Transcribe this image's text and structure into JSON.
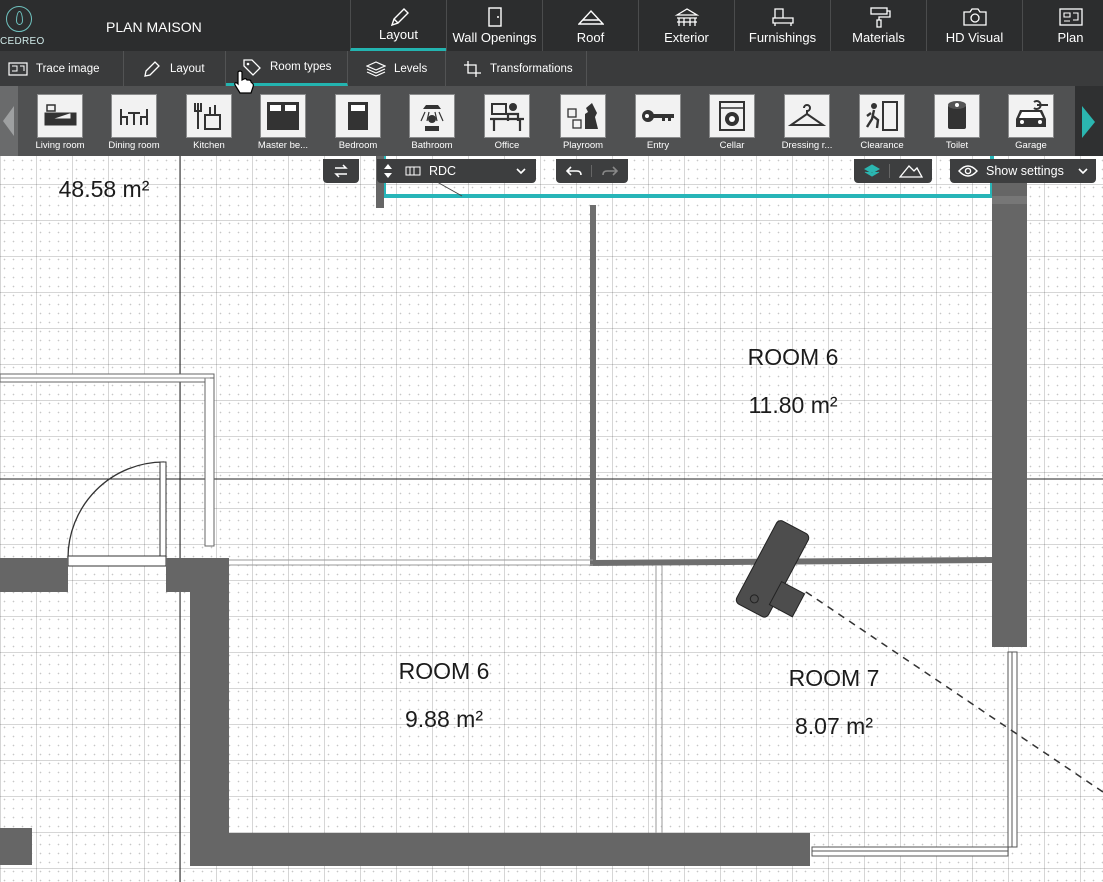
{
  "app": {
    "logo_text": "CEDREO",
    "project_title": "PLAN MAISON"
  },
  "main_tabs": [
    {
      "label": "Layout",
      "icon": "pencil-icon",
      "active": true
    },
    {
      "label": "Wall Openings",
      "icon": "door-icon",
      "active": false
    },
    {
      "label": "Roof",
      "icon": "roof-icon",
      "active": false
    },
    {
      "label": "Exterior",
      "icon": "terrace-icon",
      "active": false
    },
    {
      "label": "Furnishings",
      "icon": "furniture-icon",
      "active": false
    },
    {
      "label": "Materials",
      "icon": "paint-roller-icon",
      "active": false
    },
    {
      "label": "HD Visual",
      "icon": "camera-icon",
      "active": false
    },
    {
      "label": "Plan",
      "icon": "plan-icon",
      "active": false
    }
  ],
  "sub_tabs": [
    {
      "label": "Trace image",
      "icon": "trace-image-icon",
      "active": false
    },
    {
      "label": "Layout",
      "icon": "pencil-icon",
      "active": false
    },
    {
      "label": "Room types",
      "icon": "tag-icon",
      "active": true
    },
    {
      "label": "Levels",
      "icon": "layers-icon",
      "active": false
    },
    {
      "label": "Transformations",
      "icon": "transform-icon",
      "active": false
    }
  ],
  "room_types": [
    {
      "label": "Living room",
      "icon": "sofa-icon"
    },
    {
      "label": "Dining room",
      "icon": "dining-table-icon"
    },
    {
      "label": "Kitchen",
      "icon": "kitchen-icon"
    },
    {
      "label": "Master be...",
      "icon": "double-bed-icon"
    },
    {
      "label": "Bedroom",
      "icon": "bed-icon"
    },
    {
      "label": "Bathroom",
      "icon": "shower-icon"
    },
    {
      "label": "Office",
      "icon": "office-desk-icon"
    },
    {
      "label": "Playroom",
      "icon": "chess-knight-icon"
    },
    {
      "label": "Entry",
      "icon": "key-icon"
    },
    {
      "label": "Cellar",
      "icon": "washing-machine-icon"
    },
    {
      "label": "Dressing r...",
      "icon": "hanger-icon"
    },
    {
      "label": "Clearance",
      "icon": "exit-door-icon"
    },
    {
      "label": "Toilet",
      "icon": "toilet-paper-icon"
    },
    {
      "label": "Garage",
      "icon": "car-icon"
    }
  ],
  "controls": {
    "level": "RDC",
    "show_settings": "Show settings"
  },
  "rooms": [
    {
      "name": "",
      "area": "48.58 m²"
    },
    {
      "name": "ROOM 6",
      "area": "11.80 m²"
    },
    {
      "name": "ROOM 6",
      "area": "9.88 m²"
    },
    {
      "name": "ROOM 7",
      "area": "8.07 m²"
    }
  ],
  "colors": {
    "accent": "#23b4b0",
    "toolbar": "#2c2d2e",
    "wall": "#666666"
  }
}
